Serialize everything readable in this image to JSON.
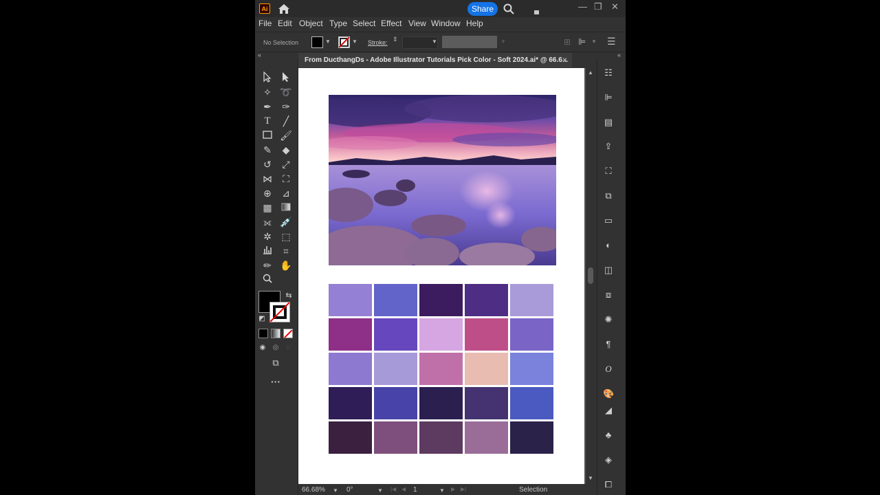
{
  "app": {
    "logo_text": "Ai",
    "share_label": "Share",
    "window_controls": [
      "—",
      "❐",
      "✕"
    ]
  },
  "menu": [
    "File",
    "Edit",
    "Object",
    "Type",
    "Select",
    "Effect",
    "View",
    "Window",
    "Help"
  ],
  "control_bar": {
    "selection_label": "No Selection",
    "stroke_label": "Stroke:"
  },
  "document": {
    "tab_title": "From DucthangDs - Adobe Illustrator Tutorials Pick Color - Soft 2024.ai* @ 66.6...",
    "close_glyph": "×"
  },
  "swatch_grid": {
    "rows": [
      [
        "#9480d4",
        "#6264c9",
        "#3c1b5e",
        "#4e2d84",
        "#a99ad9"
      ],
      [
        "#8e3088",
        "#6747bd",
        "#d6a6e2",
        "#be4e88",
        "#7a64c5"
      ],
      [
        "#8d7ad0",
        "#a79ad8",
        "#c070a8",
        "#e9bcb1",
        "#7a82dc"
      ],
      [
        "#2e1d57",
        "#4843a8",
        "#2b1f50",
        "#443370",
        "#4a5ac0"
      ],
      [
        "#3b2040",
        "#7e4f7c",
        "#5d3a60",
        "#9a6d99",
        "#2a2249"
      ]
    ]
  },
  "status_bar": {
    "zoom": "66.68%",
    "rotation": "0°",
    "artboard_number": "1",
    "tool_name": "Selection"
  },
  "colors": {
    "accent": "#1473e6",
    "app_bg": "#323232",
    "canvas_bg": "#535353",
    "artboard_bg": "#ffffff"
  }
}
